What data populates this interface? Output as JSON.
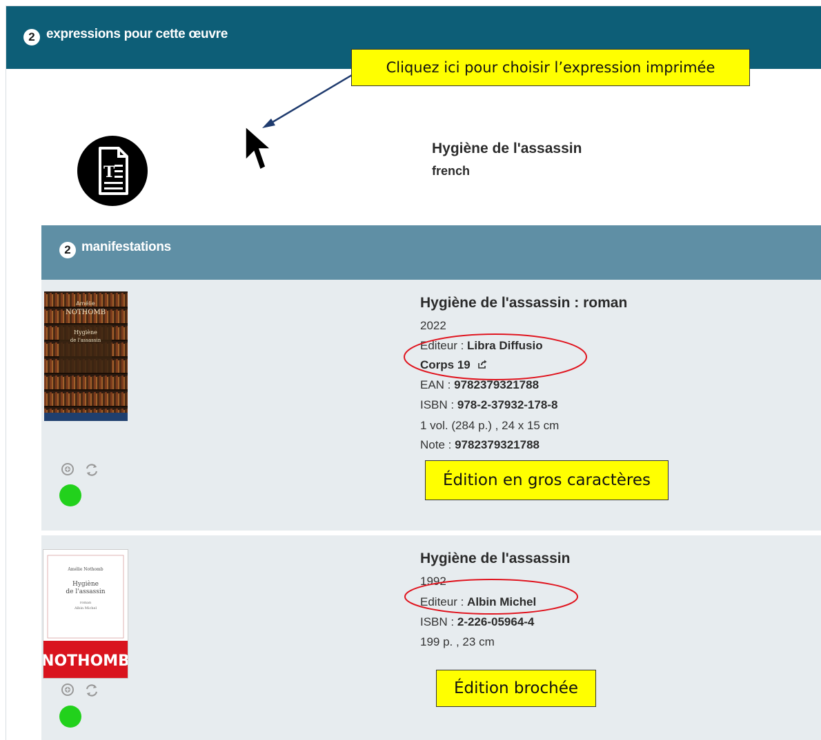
{
  "header": {
    "count": "2",
    "title": "expressions pour cette œuvre"
  },
  "callouts": {
    "top": "Cliquez ici pour choisir l’expression imprimée",
    "large_print": "Édition en gros caractères",
    "paperback": "Édition brochée"
  },
  "expression": {
    "title": "Hygiène de l'assassin",
    "language": "french",
    "icon": "text-document-icon"
  },
  "manifestations": {
    "count": "2",
    "label": "manifestations",
    "items": [
      {
        "title": "Hygiène de l'assassin : roman",
        "year": "2022",
        "publisher_label": "Editeur : ",
        "publisher": "Libra Diffusio",
        "collection": "Corps 19",
        "ean_label": "EAN : ",
        "ean": "9782379321788",
        "isbn_label": "ISBN : ",
        "isbn": "978-2-37932-178-8",
        "physical": "1 vol. (284 p.) , 24 x 15 cm",
        "note_label": "Note : ",
        "note": "9782379321788",
        "cover_text": [
          "Amélie",
          "NOTHOMB",
          "Hygiène",
          "de l'assassin"
        ],
        "status_color": "#22d11c"
      },
      {
        "title": "Hygiène de l'assassin",
        "year": "1992",
        "publisher_label": "Editeur : ",
        "publisher": "Albin Michel",
        "isbn_label": "ISBN : ",
        "isbn": "2-226-05964-4",
        "physical": "199 p. , 23 cm",
        "cover_text": [
          "Amélie Nothomb",
          "Hygiène",
          "de l'assassin",
          "roman",
          "Albin Michel",
          "NOTHOMB"
        ],
        "status_color": "#22d11c"
      }
    ]
  },
  "colors": {
    "header_bg": "#0d5e77",
    "manifest_header_bg": "#5f8fa5",
    "item_bg": "#e7ecef",
    "callout_bg": "#ffff00",
    "annotation_ring": "#e0141e",
    "arrow": "#1f3b6e"
  }
}
